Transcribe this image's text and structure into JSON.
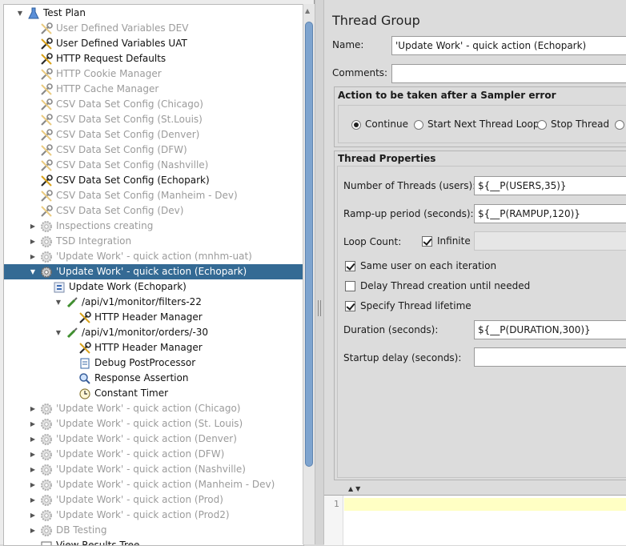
{
  "tree": {
    "items": [
      {
        "label": "Test Plan",
        "icon": "test-plan-icon",
        "state": "enabled",
        "toggle": "▼"
      },
      {
        "label": "User Defined Variables DEV",
        "icon": "wrench-icon",
        "state": "disabled",
        "toggle": ""
      },
      {
        "label": "User Defined Variables UAT",
        "icon": "wrench-icon",
        "state": "enabled",
        "toggle": ""
      },
      {
        "label": "HTTP Request Defaults",
        "icon": "wrench-icon",
        "state": "enabled",
        "toggle": ""
      },
      {
        "label": "HTTP Cookie Manager",
        "icon": "wrench-icon",
        "state": "disabled",
        "toggle": ""
      },
      {
        "label": "HTTP Cache Manager",
        "icon": "wrench-icon",
        "state": "disabled",
        "toggle": ""
      },
      {
        "label": "CSV Data Set Config (Chicago)",
        "icon": "wrench-icon",
        "state": "disabled",
        "toggle": ""
      },
      {
        "label": "CSV Data Set Config (St.Louis)",
        "icon": "wrench-icon",
        "state": "disabled",
        "toggle": ""
      },
      {
        "label": "CSV Data Set Config (Denver)",
        "icon": "wrench-icon",
        "state": "disabled",
        "toggle": ""
      },
      {
        "label": "CSV Data Set Config (DFW)",
        "icon": "wrench-icon",
        "state": "disabled",
        "toggle": ""
      },
      {
        "label": "CSV Data Set Config (Nashville)",
        "icon": "wrench-icon",
        "state": "disabled",
        "toggle": ""
      },
      {
        "label": "CSV Data Set Config (Echopark)",
        "icon": "wrench-icon",
        "state": "enabled",
        "toggle": ""
      },
      {
        "label": "CSV Data Set Config (Manheim - Dev)",
        "icon": "wrench-icon",
        "state": "disabled",
        "toggle": ""
      },
      {
        "label": "CSV Data Set Config (Dev)",
        "icon": "wrench-icon",
        "state": "disabled",
        "toggle": ""
      },
      {
        "label": "Inspections creating",
        "icon": "gear-icon",
        "state": "disabled",
        "toggle": "▶"
      },
      {
        "label": "TSD Integration",
        "icon": "gear-icon",
        "state": "disabled",
        "toggle": "▶"
      },
      {
        "label": "'Update Work' - quick action (mnhm-uat)",
        "icon": "gear-icon",
        "state": "disabled",
        "toggle": "▶"
      },
      {
        "label": "'Update Work' - quick action (Echopark)",
        "icon": "gear-icon",
        "state": "selected",
        "toggle": "▼"
      },
      {
        "label": "Update Work (Echopark)",
        "icon": "controller-icon",
        "state": "enabled",
        "toggle": ""
      },
      {
        "label": "/api/v1/monitor/filters-22",
        "icon": "pipette-icon",
        "state": "enabled",
        "toggle": "▼"
      },
      {
        "label": "HTTP Header Manager",
        "icon": "wrench-icon",
        "state": "enabled",
        "toggle": ""
      },
      {
        "label": "/api/v1/monitor/orders/-30",
        "icon": "pipette-icon",
        "state": "enabled",
        "toggle": "▼"
      },
      {
        "label": "HTTP Header Manager",
        "icon": "wrench-icon",
        "state": "enabled",
        "toggle": ""
      },
      {
        "label": "Debug PostProcessor",
        "icon": "debug-icon",
        "state": "enabled",
        "toggle": ""
      },
      {
        "label": "Response Assertion",
        "icon": "magnifier-icon",
        "state": "enabled",
        "toggle": ""
      },
      {
        "label": "Constant Timer",
        "icon": "timer-icon",
        "state": "enabled",
        "toggle": ""
      },
      {
        "label": "'Update Work' - quick action (Chicago)",
        "icon": "gear-icon",
        "state": "disabled",
        "toggle": "▶"
      },
      {
        "label": "'Update Work' - quick action (St. Louis)",
        "icon": "gear-icon",
        "state": "disabled",
        "toggle": "▶"
      },
      {
        "label": "'Update Work' - quick action (Denver)",
        "icon": "gear-icon",
        "state": "disabled",
        "toggle": "▶"
      },
      {
        "label": "'Update Work' - quick action (DFW)",
        "icon": "gear-icon",
        "state": "disabled",
        "toggle": "▶"
      },
      {
        "label": "'Update Work' - quick action (Nashville)",
        "icon": "gear-icon",
        "state": "disabled",
        "toggle": "▶"
      },
      {
        "label": "'Update Work' - quick action (Manheim - Dev)",
        "icon": "gear-icon",
        "state": "disabled",
        "toggle": "▶"
      },
      {
        "label": "'Update Work' - quick action (Prod)",
        "icon": "gear-icon",
        "state": "disabled",
        "toggle": "▶"
      },
      {
        "label": "'Update Work' - quick action (Prod2)",
        "icon": "gear-icon",
        "state": "disabled",
        "toggle": "▶"
      },
      {
        "label": "DB Testing",
        "icon": "gear-icon",
        "state": "disabled",
        "toggle": "▶"
      },
      {
        "label": "View Results Tree",
        "icon": "results-icon",
        "state": "enabled",
        "toggle": ""
      }
    ]
  },
  "panel": {
    "title": "Thread Group",
    "name_label": "Name:",
    "name_value": "'Update Work' - quick action (Echopark)",
    "comments_label": "Comments:",
    "comments_value": "",
    "sampler_error": {
      "title": "Action to be taken after a Sampler error",
      "options": [
        "Continue",
        "Start Next Thread Loop",
        "Stop Thread",
        ""
      ],
      "selected": "Continue"
    },
    "thread_props": {
      "title": "Thread Properties",
      "threads_label": "Number of Threads (users):",
      "threads_value": "${__P(USERS,35)}",
      "rampup_label": "Ramp-up period (seconds):",
      "rampup_value": "${__P(RAMPUP,120)}",
      "loop_label": "Loop Count:",
      "infinite_label": "Infinite",
      "infinite_checked": true,
      "same_user_label": "Same user on each iteration",
      "same_user_checked": true,
      "delay_label": "Delay Thread creation until needed",
      "delay_checked": false,
      "lifetime_label": "Specify Thread lifetime",
      "lifetime_checked": true,
      "duration_label": "Duration (seconds):",
      "duration_value": "${__P(DURATION,300)}",
      "startup_label": "Startup delay (seconds):",
      "startup_value": ""
    }
  },
  "editor": {
    "line_number": "1"
  },
  "colors": {
    "selection": "#346a94",
    "disabled_text": "#9b9b9b",
    "scroll_thumb": "#7ea4cf",
    "editor_highlight": "#ffffc4"
  }
}
